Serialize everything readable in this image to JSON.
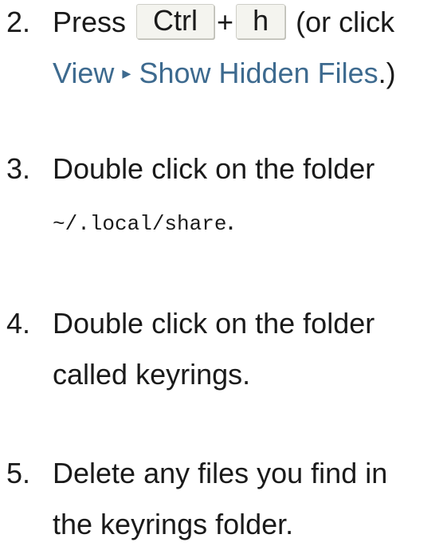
{
  "steps": [
    {
      "number": "2.",
      "press": "Press",
      "key1": "Ctrl",
      "plus": "+",
      "key2": "h",
      "or_click": "(or click",
      "menu_view": "View",
      "menu_arrow": "▸",
      "menu_item": "Show Hidden Files",
      "close": ".)"
    },
    {
      "number": "3.",
      "text": "Double click on the folder",
      "path": "~/.local/share",
      "period": "."
    },
    {
      "number": "4.",
      "line1": "Double click on the folder",
      "line2": "called keyrings."
    },
    {
      "number": "5.",
      "line1": "Delete any files you find in",
      "line2": "the keyrings folder."
    }
  ]
}
